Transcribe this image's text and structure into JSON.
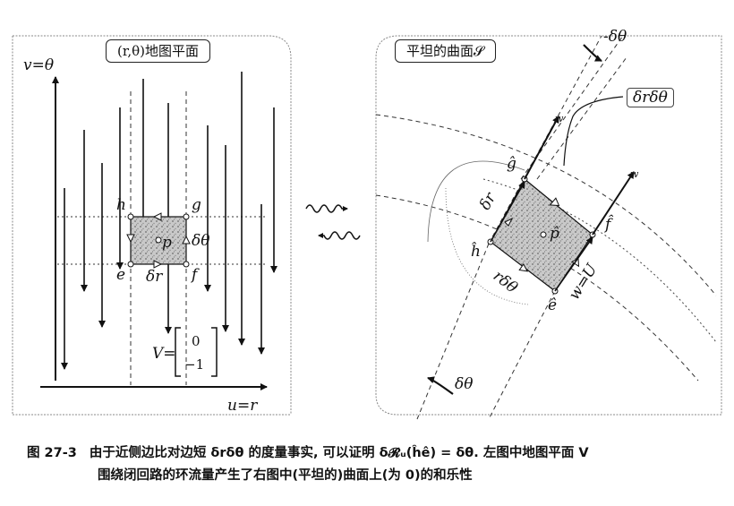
{
  "left_panel": {
    "title": "(r,θ)地图平面",
    "v_axis": "v=θ",
    "u_axis": "u=r",
    "pt_h": "h",
    "pt_g": "g",
    "pt_e": "e",
    "pt_f": "f",
    "pt_p": "p",
    "delta_r": "δr",
    "delta_theta": "δθ",
    "vector_name": "V=",
    "matrix_top": "0",
    "matrix_bottom": "−1"
  },
  "right_panel": {
    "title": "平坦的曲面𝓢",
    "neg_delta_theta": "-δθ",
    "delta_r_delta_theta": "δrδθ",
    "w_top": "w",
    "w_mid": "w",
    "pt_g": "ĝ",
    "pt_h": "ĥ",
    "pt_e": "ê",
    "pt_f": "f̂",
    "pt_p": "p̂",
    "delta_r": "δr",
    "r_delta_theta": "rδθ",
    "w_eq_u": "w=U",
    "delta_theta_bottom": "δθ"
  },
  "caption": {
    "number": "图 27-3",
    "line1": "由于近侧边比对边短 δrδθ 的度量事实, 可以证明 δ𝓡ᵤ(ĥê) = δθ. 左图中地图平面 V",
    "line2": "围绕闭回路的环流量产生了右图中(平坦的)曲面上(为 0)的和乐性"
  }
}
